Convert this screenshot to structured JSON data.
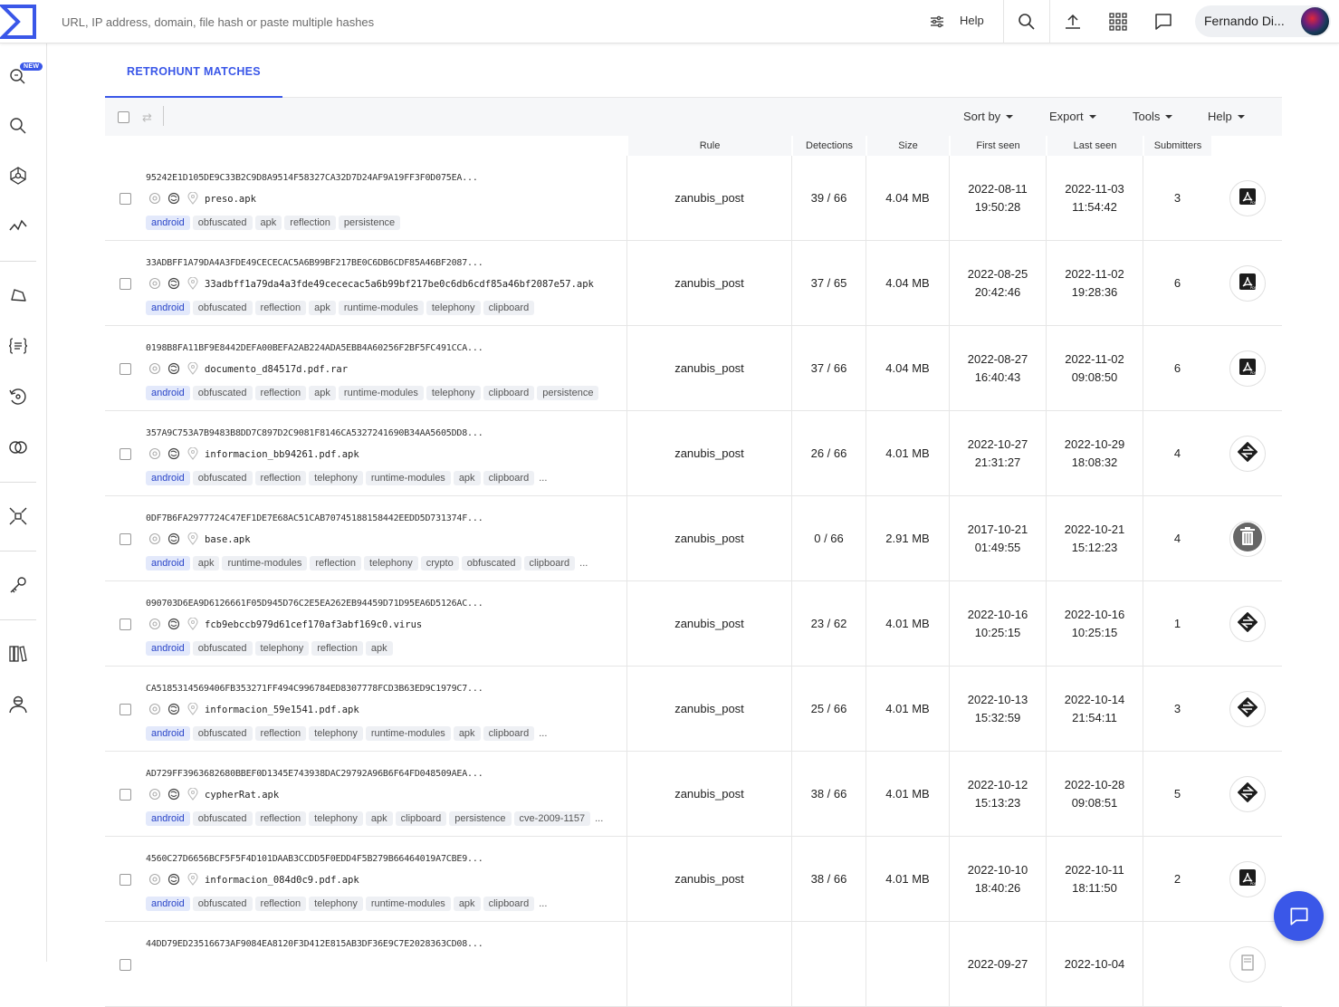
{
  "topbar": {
    "search_placeholder": "URL, IP address, domain, file hash or paste multiple hashes",
    "help_label": "Help",
    "user_name": "Fernando Di..."
  },
  "sidebar": {
    "new_badge": "NEW"
  },
  "tabs": [
    {
      "label": "RETROHUNT MATCHES",
      "active": true
    }
  ],
  "toolbar": {
    "sort_by": "Sort by",
    "export": "Export",
    "tools": "Tools",
    "help": "Help"
  },
  "columns": {
    "rule": "Rule",
    "detections": "Detections",
    "size": "Size",
    "first_seen": "First seen",
    "last_seen": "Last seen",
    "submitters": "Submitters"
  },
  "rows": [
    {
      "hash": "95242E1D105DE9C33B2C9D8A9514F58327CA32D7D24AF9A19FF3F0D075EA...",
      "filename": "preso.apk",
      "tags": [
        "android",
        "obfuscated",
        "apk",
        "reflection",
        "persistence"
      ],
      "more": "",
      "rule": "zanubis_post",
      "detections": "39 / 66",
      "size": "4.04 MB",
      "first_seen_date": "2022-08-11",
      "first_seen_time": "19:50:28",
      "last_seen_date": "2022-11-03",
      "last_seen_time": "11:54:42",
      "submitters": "3",
      "icon": "pdf-icon"
    },
    {
      "hash": "33ADBFF1A79DA4A3FDE49CECECAC5A6B99BF217BE0C6DB6CDF85A46BF2087...",
      "filename": "33adbff1a79da4a3fde49cececac5a6b99bf217be0c6db6cdf85a46bf2087e57.apk",
      "tags": [
        "android",
        "obfuscated",
        "reflection",
        "apk",
        "runtime-modules",
        "telephony",
        "clipboard"
      ],
      "more": "",
      "rule": "zanubis_post",
      "detections": "37 / 65",
      "size": "4.04 MB",
      "first_seen_date": "2022-08-25",
      "first_seen_time": "20:42:46",
      "last_seen_date": "2022-11-02",
      "last_seen_time": "19:28:36",
      "submitters": "6",
      "icon": "pdf-icon"
    },
    {
      "hash": "0198B8FA11BF9E8442DEFA00BEFA2AB224ADA5EBB4A60256F2BF5FC491CCA...",
      "filename": "documento_d84517d.pdf.rar",
      "tags": [
        "android",
        "obfuscated",
        "reflection",
        "apk",
        "runtime-modules",
        "telephony",
        "clipboard",
        "persistence"
      ],
      "more": "",
      "rule": "zanubis_post",
      "detections": "37 / 66",
      "size": "4.04 MB",
      "first_seen_date": "2022-08-27",
      "first_seen_time": "16:40:43",
      "last_seen_date": "2022-11-02",
      "last_seen_time": "09:08:50",
      "submitters": "6",
      "icon": "pdf-icon"
    },
    {
      "hash": "357A9C753A7B9483B8DD7C897D2C9081F8146CA5327241690B34AA5605DD8...",
      "filename": "informacion_bb94261.pdf.apk",
      "tags": [
        "android",
        "obfuscated",
        "reflection",
        "telephony",
        "runtime-modules",
        "apk",
        "clipboard"
      ],
      "more": "...",
      "rule": "zanubis_post",
      "detections": "26 / 66",
      "size": "4.01 MB",
      "first_seen_date": "2022-10-27",
      "first_seen_time": "21:31:27",
      "last_seen_date": "2022-10-29",
      "last_seen_time": "18:08:32",
      "submitters": "4",
      "icon": "apk-icon"
    },
    {
      "hash": "0DF7B6FA2977724C47EF1DE7E68AC51CAB70745188158442EEDD5D731374F...",
      "filename": "base.apk",
      "tags": [
        "android",
        "apk",
        "runtime-modules",
        "reflection",
        "telephony",
        "crypto",
        "obfuscated",
        "clipboard"
      ],
      "more": "...",
      "rule": "zanubis_post",
      "detections": "0 / 66",
      "size": "2.91 MB",
      "first_seen_date": "2017-10-21",
      "first_seen_time": "01:49:55",
      "last_seen_date": "2022-10-21",
      "last_seen_time": "15:12:23",
      "submitters": "4",
      "icon": "trash-icon"
    },
    {
      "hash": "090703D6EA9D6126661F05D945D76C2E5EA262EB94459D71D95EA6D5126AC...",
      "filename": "fcb9ebccb979d61cef170af3abf169c0.virus",
      "tags": [
        "android",
        "obfuscated",
        "telephony",
        "reflection",
        "apk"
      ],
      "more": "",
      "rule": "zanubis_post",
      "detections": "23 / 62",
      "size": "4.01 MB",
      "first_seen_date": "2022-10-16",
      "first_seen_time": "10:25:15",
      "last_seen_date": "2022-10-16",
      "last_seen_time": "10:25:15",
      "submitters": "1",
      "icon": "apk-icon"
    },
    {
      "hash": "CA5185314569406FB353271FF494C996784ED8307778FCD3B63ED9C1979C7...",
      "filename": "informacion_59e1541.pdf.apk",
      "tags": [
        "android",
        "obfuscated",
        "reflection",
        "telephony",
        "runtime-modules",
        "apk",
        "clipboard"
      ],
      "more": "...",
      "rule": "zanubis_post",
      "detections": "25 / 66",
      "size": "4.01 MB",
      "first_seen_date": "2022-10-13",
      "first_seen_time": "15:32:59",
      "last_seen_date": "2022-10-14",
      "last_seen_time": "21:54:11",
      "submitters": "3",
      "icon": "apk-icon"
    },
    {
      "hash": "AD729FF3963682680BBEF0D1345E743938DAC29792A96B6F64FD048509AEA...",
      "filename": "cypherRat.apk",
      "tags": [
        "android",
        "obfuscated",
        "reflection",
        "telephony",
        "apk",
        "clipboard",
        "persistence",
        "cve-2009-1157"
      ],
      "more": "...",
      "rule": "zanubis_post",
      "detections": "38 / 66",
      "size": "4.01 MB",
      "first_seen_date": "2022-10-12",
      "first_seen_time": "15:13:23",
      "last_seen_date": "2022-10-28",
      "last_seen_time": "09:08:51",
      "submitters": "5",
      "icon": "apk-icon"
    },
    {
      "hash": "4560C27D6656BCF5F5F4D101DAAB3CCDD5F0EDD4F5B279B66464019A7CBE9...",
      "filename": "informacion_084d0c9.pdf.apk",
      "tags": [
        "android",
        "obfuscated",
        "reflection",
        "telephony",
        "runtime-modules",
        "apk",
        "clipboard"
      ],
      "more": "...",
      "rule": "zanubis_post",
      "detections": "38 / 66",
      "size": "4.01 MB",
      "first_seen_date": "2022-10-10",
      "first_seen_time": "18:40:26",
      "last_seen_date": "2022-10-11",
      "last_seen_time": "18:11:50",
      "submitters": "2",
      "icon": "pdf-icon"
    },
    {
      "hash": "44DD79ED23516673AF9084EA8120F3D412E815AB3DF36E9C7E2028363CD08...",
      "filename": "",
      "tags": [],
      "more": "",
      "rule": "",
      "detections": "",
      "size": "",
      "first_seen_date": "2022-09-27",
      "first_seen_time": "",
      "last_seen_date": "2022-10-04",
      "last_seen_time": "",
      "submitters": "",
      "icon": "doc-icon"
    }
  ]
}
